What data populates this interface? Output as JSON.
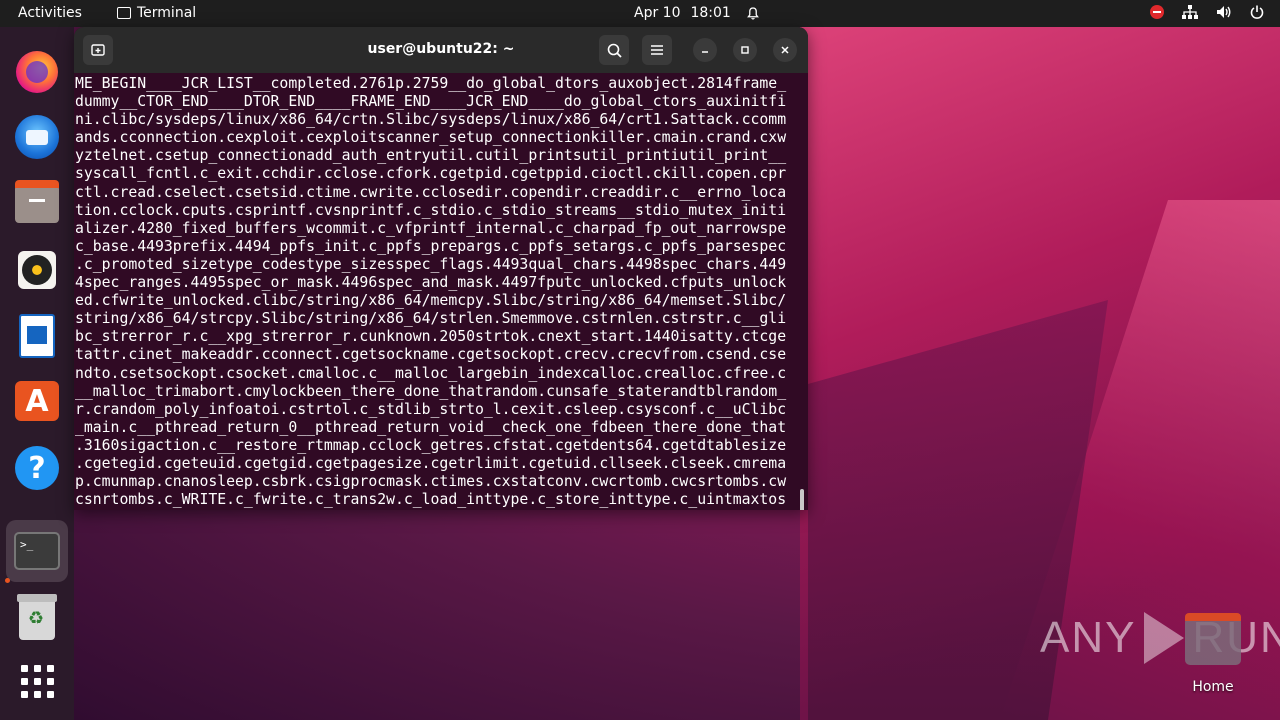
{
  "topbar": {
    "activities_label": "Activities",
    "app_name": "Terminal",
    "date": "Apr 10",
    "time": "18:01"
  },
  "dock": {
    "items": [
      {
        "name": "Firefox",
        "icon": "firefox-icon"
      },
      {
        "name": "Thunderbird",
        "icon": "thunderbird-icon"
      },
      {
        "name": "Files",
        "icon": "files-icon"
      },
      {
        "name": "Rhythmbox",
        "icon": "rhythmbox-icon"
      },
      {
        "name": "LibreOffice Writer",
        "icon": "writer-icon"
      },
      {
        "name": "Ubuntu Software",
        "icon": "software-store-icon"
      },
      {
        "name": "Help",
        "icon": "help-icon"
      },
      {
        "name": "Terminal",
        "icon": "terminal-icon"
      },
      {
        "name": "Trash",
        "icon": "trash-icon"
      },
      {
        "name": "Show Applications",
        "icon": "app-grid-icon"
      }
    ],
    "store_glyph": "A",
    "help_glyph": "?",
    "term_glyph": ">_"
  },
  "terminal": {
    "title": "user@ubuntu22: ~",
    "output": "ME_BEGIN____JCR_LIST__completed.2761p.2759__do_global_dtors_auxobject.2814frame_\ndummy__CTOR_END____DTOR_END____FRAME_END____JCR_END____do_global_ctors_auxinitfi\nni.clibc/sysdeps/linux/x86_64/crtn.Slibc/sysdeps/linux/x86_64/crt1.Sattack.ccomm\nands.cconnection.cexploit.cexploitscanner_setup_connectionkiller.cmain.crand.cxw\nyztelnet.csetup_connectionadd_auth_entryutil.cutil_printsutil_printiutil_print__\nsyscall_fcntl.c_exit.cchdir.cclose.cfork.cgetpid.cgetppid.cioctl.ckill.copen.cpr\nctl.cread.cselect.csetsid.ctime.cwrite.cclosedir.copendir.creaddir.c__errno_loca\ntion.cclock.cputs.csprintf.cvsnprintf.c_stdio.c_stdio_streams__stdio_mutex_initi\nalizer.4280_fixed_buffers_wcommit.c_vfprintf_internal.c_charpad_fp_out_narrowspe\nc_base.4493prefix.4494_ppfs_init.c_ppfs_prepargs.c_ppfs_setargs.c_ppfs_parsespec\n.c_promoted_sizetype_codestype_sizesspec_flags.4493qual_chars.4498spec_chars.449\n4spec_ranges.4495spec_or_mask.4496spec_and_mask.4497fputc_unlocked.cfputs_unlock\ned.cfwrite_unlocked.clibc/string/x86_64/memcpy.Slibc/string/x86_64/memset.Slibc/\nstring/x86_64/strcpy.Slibc/string/x86_64/strlen.Smemmove.cstrnlen.cstrstr.c__gli\nbc_strerror_r.c__xpg_strerror_r.cunknown.2050strtok.cnext_start.1440isatty.ctcge\ntattr.cinet_makeaddr.cconnect.cgetsockname.cgetsockopt.crecv.crecvfrom.csend.cse\nndto.csetsockopt.csocket.cmalloc.c__malloc_largebin_indexcalloc.crealloc.cfree.c\n__malloc_trimabort.cmylockbeen_there_done_thatrandom.cunsafe_staterandtblrandom_\nr.crandom_poly_infoatoi.cstrtol.c_stdlib_strto_l.cexit.csleep.csysconf.c__uClibc\n_main.c__pthread_return_0__pthread_return_void__check_one_fdbeen_there_done_that\n.3160sigaction.c__restore_rtmmap.cclock_getres.cfstat.cgetdents64.cgetdtablesize\n.cgetegid.cgeteuid.cgetgid.cgetpagesize.cgetrlimit.cgetuid.cllseek.clseek.cmrema\np.cmunmap.cnanosleep.csbrk.csigprocmask.ctimes.cxstatconv.cwcrtomb.cwcsrtombs.cw\ncsnrtombs.c_WRITE.c_fwrite.c_trans2w.c_load_inttype.c_store_inttype.c_uintmaxtos"
  },
  "desktop": {
    "home_label": "Home",
    "watermark": "ANY RUN"
  },
  "colors": {
    "terminal_bg": "#300a24",
    "accent": "#e95420"
  }
}
